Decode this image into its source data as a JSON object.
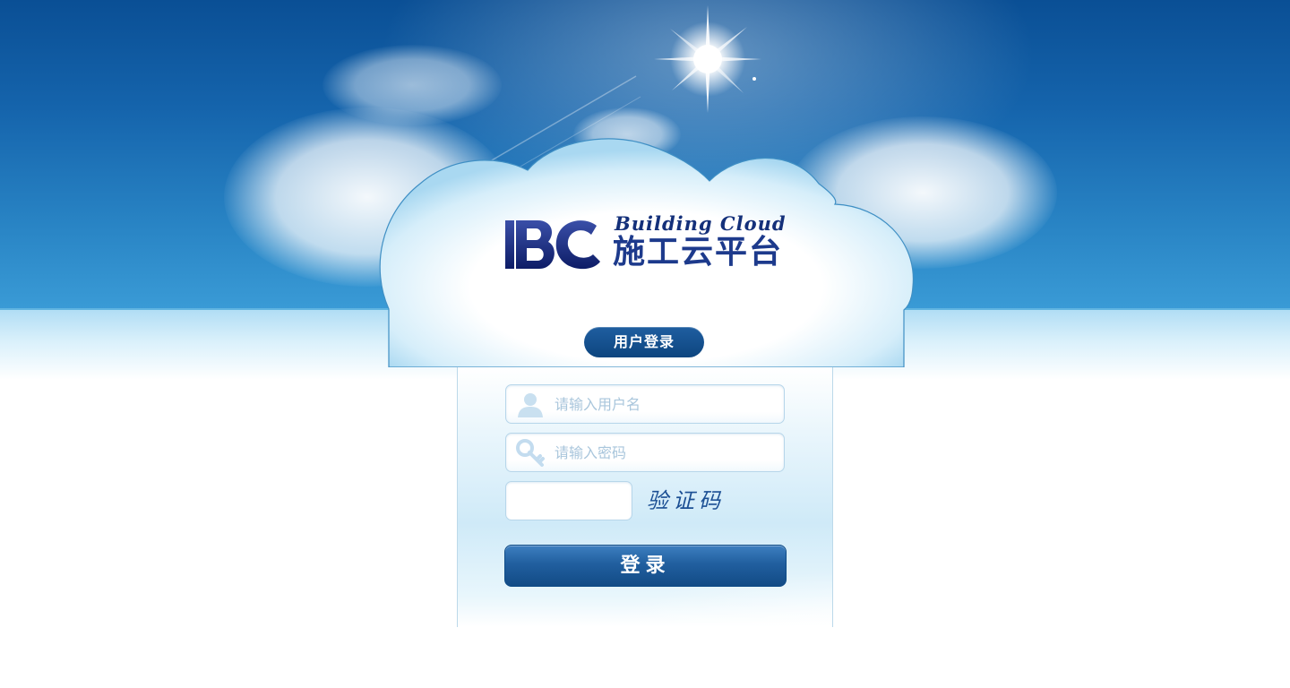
{
  "logo": {
    "brand_letters": "BC",
    "english_name": "Building Cloud",
    "chinese_name": "施工云平台"
  },
  "login": {
    "badge_label": "用户登录",
    "username_placeholder": "请输入用户名",
    "password_placeholder": "请输入密码",
    "captcha_text": "验证码",
    "submit_label": "登录"
  },
  "colors": {
    "sky_top": "#0a4f95",
    "sky_bottom": "#3a9bd6",
    "brand_navy": "#14307a",
    "button": "#215f9f"
  },
  "icons": [
    "sun-icon",
    "user-icon",
    "key-icon"
  ]
}
